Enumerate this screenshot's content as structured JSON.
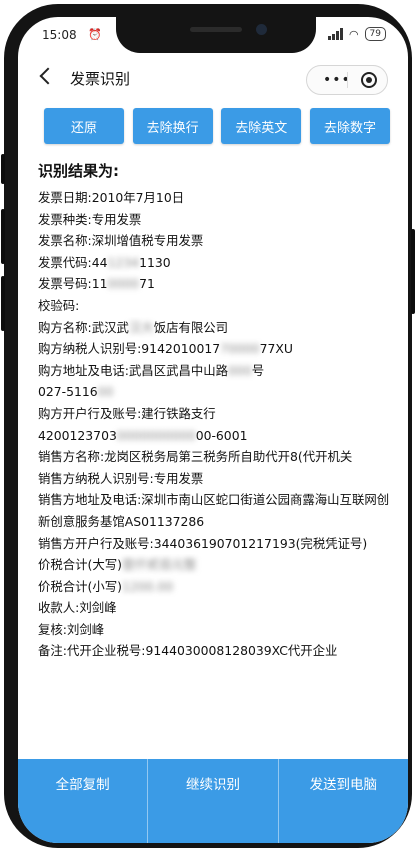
{
  "status_bar": {
    "time": "15:08",
    "battery": "79"
  },
  "nav": {
    "title": "发票识别",
    "more_label": "•••"
  },
  "actions": [
    {
      "label": "还原"
    },
    {
      "label": "去除换行"
    },
    {
      "label": "去除英文"
    },
    {
      "label": "去除数字"
    }
  ],
  "result": {
    "heading": "识别结果为:",
    "lines": {
      "date": "发票日期:2010年7月10日",
      "kind": "发票种类:专用发票",
      "name": "发票名称:深圳增值税专用发票",
      "code_prefix": "发票代码:44",
      "code_blur": "1234",
      "code_suffix": "1130",
      "number_prefix": "发票号码:11",
      "number_blur": "0000",
      "number_suffix": "71",
      "check": "校验码:",
      "buyer_prefix": "购方名称:武汉武",
      "buyer_blur": "汉大",
      "buyer_suffix": "饭店有限公司",
      "buyer_tax_prefix": "购方纳税人识别号:9142010017",
      "buyer_tax_blur": "70000",
      "buyer_tax_suffix": "77XU",
      "buyer_addr_prefix": "购方地址及电话:武昌区武昌中山路",
      "buyer_addr_blur": "000",
      "buyer_addr_suffix": "号",
      "buyer_phone_prefix": "027-5116",
      "buyer_phone_blur": "00",
      "buyer_bank": "购方开户行及账号:建行铁路支行",
      "buyer_acct_prefix": "4200123703",
      "buyer_acct_blur": "0000000000",
      "buyer_acct_suffix": "00-6001",
      "seller_name": "销售方名称:龙岗区税务局第三税务所自助代开8(代开机关",
      "seller_tax": "销售方纳税人识别号:专用发票",
      "seller_addr": "销售方地址及电话:深圳市南山区蛇口街道公园商露海山互联网创新创意服务基馆AS01137286",
      "seller_bank": "销售方开户行及账号:344036190701217193(完税凭证号)",
      "total_upper_label": "价税合计(大写)",
      "total_upper_blur": "壹仟贰佰元整",
      "total_lower_label": "价税合计(小写)",
      "total_lower_blur": "1200.00",
      "payee": "收款人:刘剑峰",
      "reviewer": "复核:刘剑峰",
      "remark": "备注:代开企业税号:9144030008128039XC代开企业"
    }
  },
  "bottom": [
    {
      "label": "全部复制"
    },
    {
      "label": "继续识别"
    },
    {
      "label": "发送到电脑"
    }
  ]
}
